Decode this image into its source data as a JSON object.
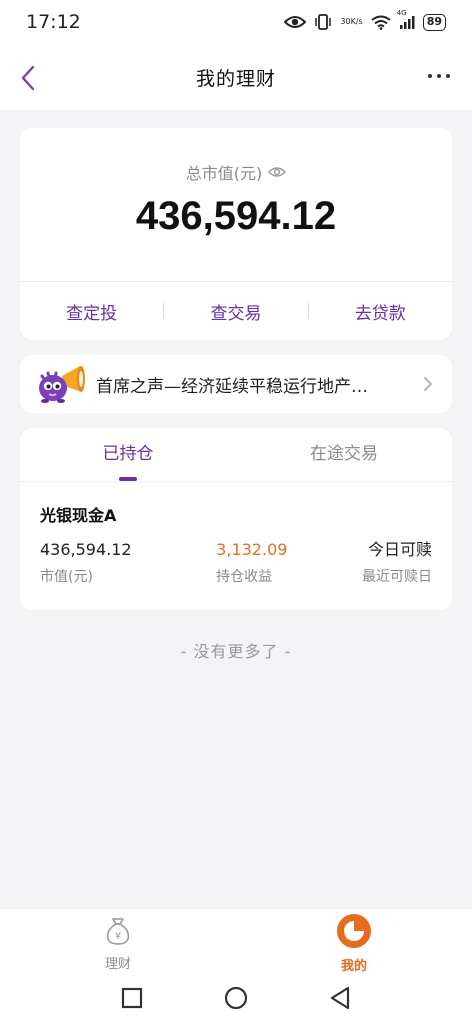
{
  "status_bar": {
    "time": "17:12",
    "net_speed_value": "30",
    "net_speed_unit": "K/s",
    "signal_label": "4G",
    "battery": "89"
  },
  "header": {
    "title": "我的理财"
  },
  "summary": {
    "total_label": "总市值(元)",
    "total_value": "436,594.12",
    "actions": [
      "查定投",
      "查交易",
      "去贷款"
    ]
  },
  "news": {
    "text": "首席之声—经济延续平稳运行地产…"
  },
  "holdings": {
    "tabs": [
      {
        "label": "已持仓",
        "active": true
      },
      {
        "label": "在途交易",
        "active": false
      }
    ],
    "fund": {
      "name": "光银现金A",
      "market_value": "436,594.12",
      "market_value_label": "市值(元)",
      "profit": "3,132.09",
      "profit_label": "持仓收益",
      "redeem_date": "今日可赎",
      "redeem_label": "最近可赎日"
    }
  },
  "footer_note": "- 没有更多了 -",
  "bottom_nav": [
    {
      "label": "理财",
      "icon": "money-bag-icon",
      "active": false
    },
    {
      "label": "我的",
      "icon": "pie-chart-icon",
      "active": true
    }
  ],
  "colors": {
    "accent_purple": "#6a2fa3",
    "profit_orange": "#e0702a",
    "active_tab_orange": "#e86a1c"
  }
}
